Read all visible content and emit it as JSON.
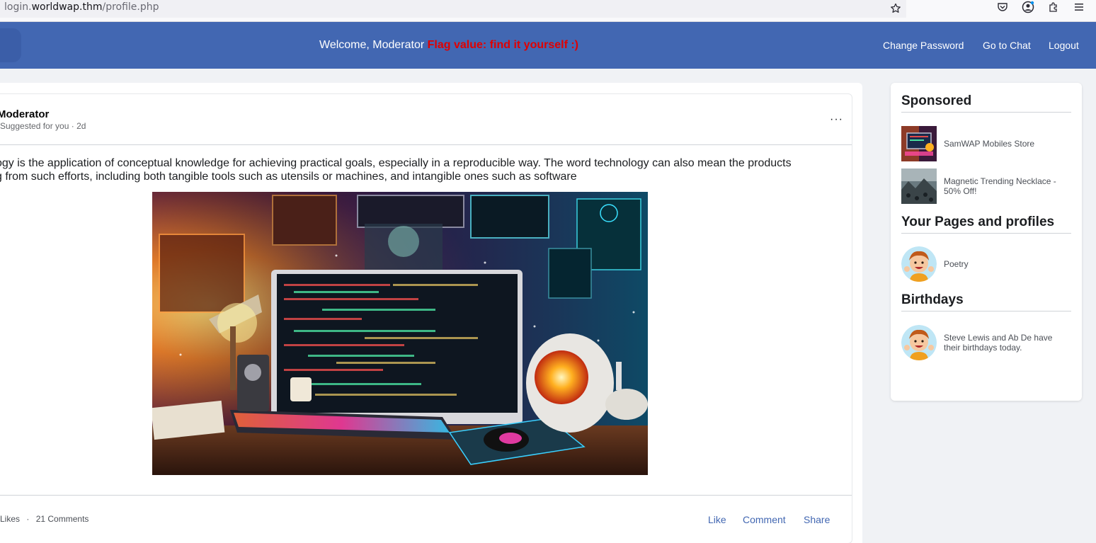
{
  "browser": {
    "url_scheme_host": "login.",
    "url_domain": "worldwap.thm",
    "url_path": "/profile.php",
    "icons": [
      "star-icon",
      "pocket-icon",
      "account-icon",
      "extensions-icon",
      "menu-icon"
    ]
  },
  "header": {
    "welcome_text": "Welcome, Moderator",
    "flag_text": "Flag value: find it yourself :)",
    "nav": {
      "change_password": "Change Password",
      "go_to_chat": "Go to Chat",
      "logout": "Logout"
    }
  },
  "post": {
    "author": "Moderator",
    "meta": "Suggested for you · 2d",
    "more": "···",
    "text_line1": "ogy is the application of conceptual knowledge for achieving practical goals, especially in a reproducible way. The word technology can also mean the products",
    "text_line2": "g from such efforts, including both tangible tools such as utensils or machines, and intangible ones such as software",
    "stats": {
      "likes": "Likes",
      "separator": "·",
      "comments": "21 Comments"
    },
    "actions": {
      "like": "Like",
      "comment": "Comment",
      "share": "Share"
    }
  },
  "sidebar": {
    "sponsored_title": "Sponsored",
    "sponsored": [
      {
        "label": "SamWAP Mobiles Store"
      },
      {
        "label": "Magnetic Trending Necklace - 50% Off!"
      }
    ],
    "pages_title": "Your Pages and profiles",
    "pages": [
      {
        "label": "Poetry"
      }
    ],
    "birthdays_title": "Birthdays",
    "birthdays": [
      {
        "label": "Steve Lewis and Ab De have their birthdays today."
      }
    ]
  },
  "colors": {
    "header_bg": "#4267b2",
    "flag": "#e00000",
    "link": "#4267b2",
    "page_bg": "#f0f2f5"
  }
}
